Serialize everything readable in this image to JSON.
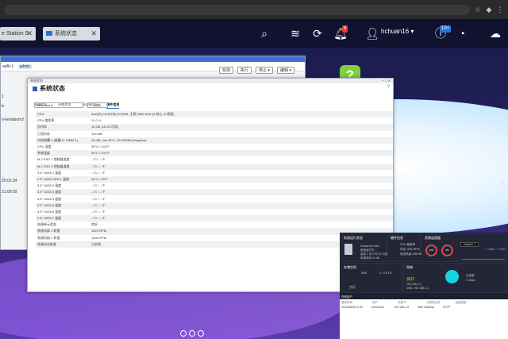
{
  "browser": {},
  "taskbar": {
    "tabs": [
      {
        "label": "e Station 5"
      },
      {
        "label": "系统状态"
      }
    ],
    "notification_badge": "6",
    "user": "hchuan16 ▾",
    "update_badge": "10+"
  },
  "back_window": {
    "title_left": "aafb-1",
    "tag": "admin",
    "buttons": [
      "检测",
      "执行",
      "停止 ▾",
      "编辑 ▾"
    ],
    "side_lines": [
      "1",
      "b",
      "ri-ker/abuhcf",
      "20:02:34",
      "21:00:59"
    ]
  },
  "main_window": {
    "titlebar": "系统状态",
    "heading": "系统状态",
    "tabs": [
      "系统信息",
      "网络状态",
      "系统服务",
      "硬件信息"
    ],
    "active_tab_index": 3,
    "select_value": "NAS-host ▾",
    "refresh_label": "刷新",
    "rows": [
      {
        "k": "CPU",
        "v": "Intel(R) Core(TM) i3 N305, 主频 2600 MHz (8 核心, 8 线程)"
      },
      {
        "k": "CPU 使用率",
        "v": "10.0 %",
        "alert": true
      },
      {
        "k": "总内存",
        "v": "16 GB (15.03 可用)"
      },
      {
        "k": "已用内存",
        "v": "193 MB"
      },
      {
        "k": "内存插槽 1 (插槽 A: DIMM 1)",
        "v": "16 GB, non-ECC, SO-DIMM (Kingston)"
      },
      {
        "k": "CPU 温度",
        "v": "39°C / 102°F"
      },
      {
        "k": "系统温度",
        "v": "39°C / 102°F"
      },
      {
        "k": "M.2 SSD 1 控制器温度",
        "v": "--°C / --°F"
      },
      {
        "k": "M.2 SSD 2 控制器温度",
        "v": "--°C / --°F"
      },
      {
        "k": "3.5\" SATA 1 温度",
        "v": "--°C / --°F"
      },
      {
        "k": "2.5\" SATA HDD 1 温度",
        "v": "34°C / 93°F"
      },
      {
        "k": "3.5\" SATA 2 温度",
        "v": "--°C / --°F"
      },
      {
        "k": "3.5\" SATA 3 温度",
        "v": "--°C / --°F"
      },
      {
        "k": "3.5\" SATA 4 温度",
        "v": "--°C / --°F"
      },
      {
        "k": "3.5\" SATA 5 温度",
        "v": "--°C / --°F"
      },
      {
        "k": "3.5\" SATA 6 温度",
        "v": "--°C / --°F"
      },
      {
        "k": "2.5\" SATA 7 温度",
        "v": "--°C / --°F"
      },
      {
        "k": "电源单元状态",
        "v": "良好"
      },
      {
        "k": "系统风扇 1 转速",
        "v": "1023 RPM"
      },
      {
        "k": "系统风扇 2 转速",
        "v": "1000 RPM"
      },
      {
        "k": "电源自动恢复",
        "v": "已启用"
      }
    ]
  },
  "desktop": {
    "app_icon_glyph": "?"
  },
  "dashboard": {
    "system_status_title": "系统运行状态",
    "hardware_title": "硬件信息",
    "resource_title": "资源监视器",
    "device_name": "hchuan16-NAS",
    "device_lines": [
      "系统运行中",
      "启动 1 天 0 时 41 分钟",
      "本地时间 21:46"
    ],
    "hw_lines": [
      "CPU 使用率",
      "内存 1050 RPM",
      "系统风扇 1056 RPM"
    ],
    "cpu_pct": "10%",
    "mem_pct": "3%",
    "adapter": "Adapter 1",
    "rates": [
      "↑ 1 KB/s",
      "↓ 0 KB/s"
    ],
    "storage_title": "存储空间",
    "storage_status": "良好",
    "network_title": "网络",
    "volume_label": "NAS",
    "volume_size": "1 / 3.5 TB",
    "status_good": "良好",
    "network_lines": [
      "192.168.1.X",
      "DNS: 192.168.1.1"
    ],
    "network_side": [
      "已连接",
      "1 Gbps"
    ],
    "online_users_title": "在线用户",
    "online_headers": [
      "登录时间",
      "用户",
      "来源 IP",
      "计算机名称",
      "连接类型"
    ],
    "online_row": [
      "2023/05/06 21:10",
      "hchuan16",
      "192.168.1.5",
      "Web Desktop",
      "HTTP"
    ],
    "clock": "21:46",
    "date": "2023/05/06"
  }
}
